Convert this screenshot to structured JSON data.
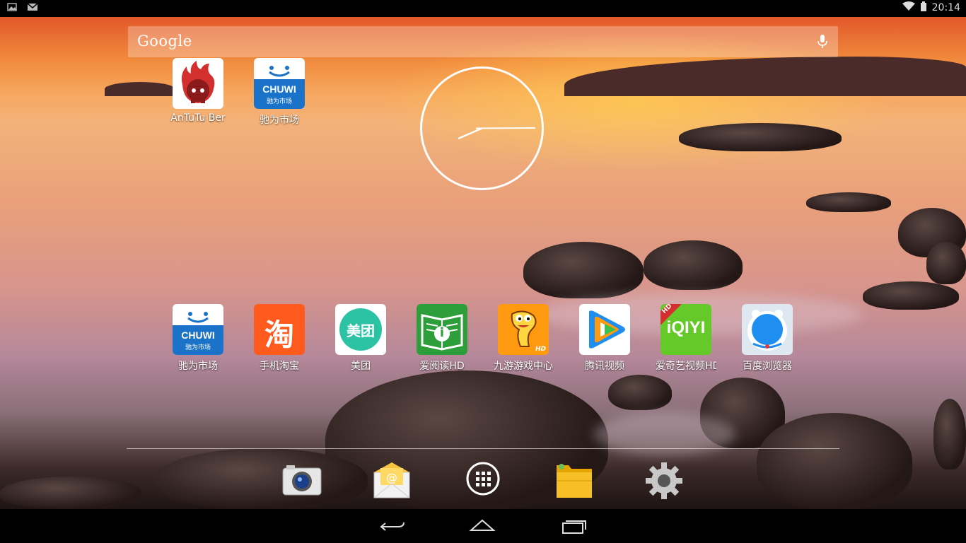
{
  "status_bar": {
    "time": "20:14",
    "left_icons": [
      "image-icon",
      "gmail-icon"
    ],
    "right_icons": [
      "wifi-icon",
      "battery-icon"
    ]
  },
  "search": {
    "logo_text": "Google",
    "mic_icon": "microphone-icon"
  },
  "clock": {
    "type": "analog-clock-widget"
  },
  "top_apps": [
    {
      "label": "AnTuTu Ber",
      "icon": "antutu-icon"
    },
    {
      "label": "驰为市场",
      "icon": "chuwi-market-icon",
      "brand": "CHUWI",
      "subtext": "驰为市场"
    }
  ],
  "row_apps": [
    {
      "label": "驰为市场",
      "icon": "chuwi-market-icon",
      "brand": "CHUWI",
      "subtext": "驰为市场"
    },
    {
      "label": "手机淘宝",
      "icon": "taobao-icon",
      "glyph": "淘"
    },
    {
      "label": "美团",
      "icon": "meituan-icon",
      "glyph": "美团"
    },
    {
      "label": "爱阅读HD",
      "icon": "aiyuedu-icon",
      "glyph": "i"
    },
    {
      "label": "九游游戏中心",
      "icon": "jiuyou-icon",
      "badge": "HD"
    },
    {
      "label": "腾讯视频",
      "icon": "tencent-video-icon"
    },
    {
      "label": "爱奇艺视频HD",
      "icon": "iqiyi-icon",
      "glyph": "iQIYI",
      "badge": "HD"
    },
    {
      "label": "百度浏览器",
      "icon": "baidu-browser-icon"
    }
  ],
  "dock": [
    {
      "name": "camera",
      "icon": "camera-icon"
    },
    {
      "name": "email",
      "icon": "email-icon"
    },
    {
      "name": "all-apps",
      "icon": "app-drawer-icon"
    },
    {
      "name": "file-manager",
      "icon": "folder-icon"
    },
    {
      "name": "settings",
      "icon": "gear-icon"
    }
  ],
  "nav": [
    {
      "name": "back",
      "icon": "back-icon"
    },
    {
      "name": "home",
      "icon": "home-icon"
    },
    {
      "name": "recents",
      "icon": "recents-icon"
    }
  ],
  "colors": {
    "chuwi_blue": "#1a73c8",
    "taobao_orange": "#ff5a1e",
    "meituan_teal": "#2cc3a4",
    "aiyuedu_green": "#2e9e3a",
    "jiuyou_orange": "#ff9a10",
    "iqiyi_green": "#66c92a",
    "baidu_blue": "#1e8ef0"
  }
}
